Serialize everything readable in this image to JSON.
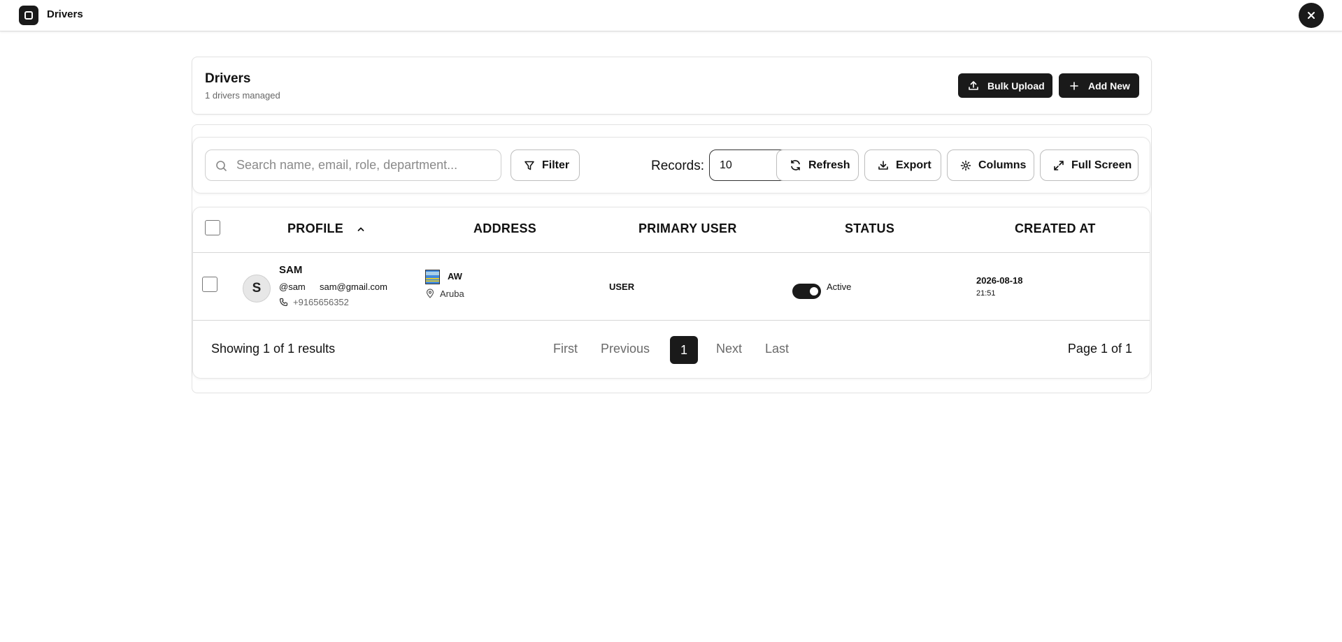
{
  "window": {
    "title": "Drivers",
    "icon": "app-square-icon",
    "close_icon": "close-icon"
  },
  "header": {
    "title": "Drivers",
    "subtitle": "1 drivers managed",
    "bulk_upload_label": "Bulk Upload",
    "add_new_label": "Add New"
  },
  "toolbar": {
    "search_placeholder": "Search name, email, role, department...",
    "search_value": "",
    "filter_label": "Filter",
    "records_label": "Records:",
    "records_value": "10",
    "refresh_label": "Refresh",
    "export_label": "Export",
    "columns_label": "Columns",
    "fullscreen_label": "Full Screen"
  },
  "table": {
    "columns": [
      "PROFILE",
      "ADDRESS",
      "PRIMARY USER",
      "STATUS",
      "CREATED AT"
    ],
    "sort_column": "PROFILE",
    "sort_direction": "ascending",
    "rows": [
      {
        "avatar_initial": "S",
        "name": "SAM",
        "username": "@sam",
        "email": "sam@gmail.com",
        "phone": "+9165656352",
        "country_code": "AW",
        "country": "Aruba",
        "primary_user": "USER",
        "status_label": "Active",
        "status_on": true,
        "created_date": "2026-08-18",
        "created_time": "21:51"
      }
    ]
  },
  "pagination": {
    "showing": "Showing 1 of 1 results",
    "first": "First",
    "previous": "Previous",
    "current": "1",
    "next": "Next",
    "last": "Last",
    "page_of": "Page 1 of 1"
  },
  "colors": {
    "primary": "#1a1a1a",
    "border": "#e2e2e2",
    "muted_text": "#666666"
  }
}
